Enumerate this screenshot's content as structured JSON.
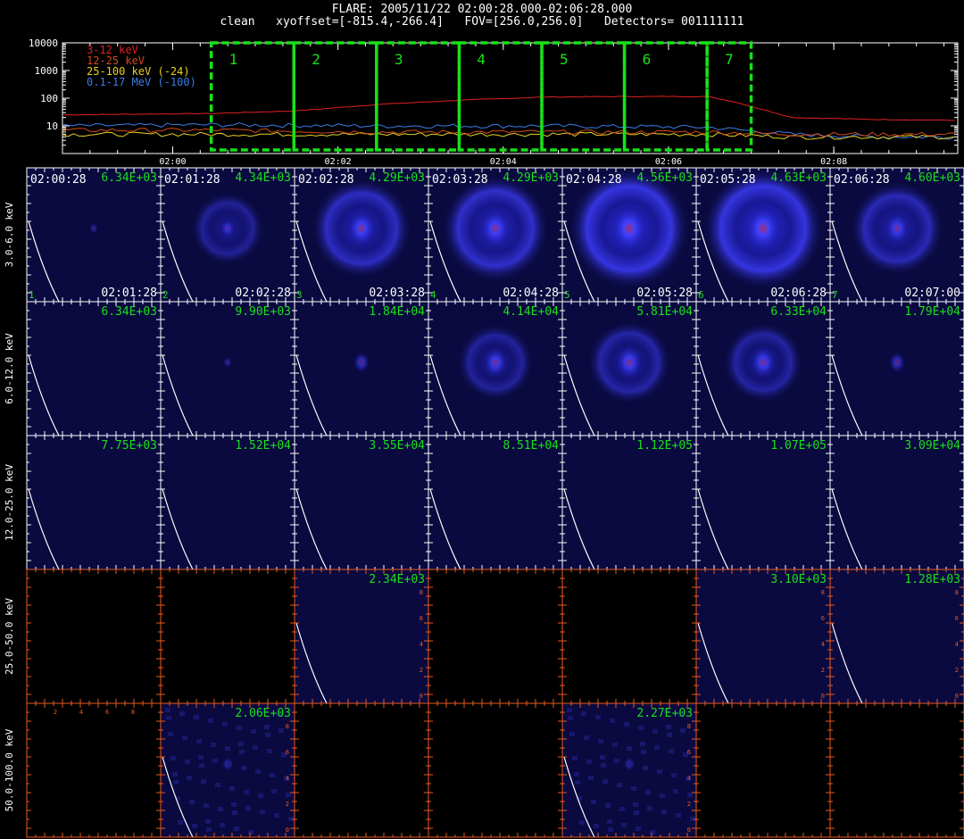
{
  "header": {
    "title": "FLARE: 2005/11/22 02:00:28.000-02:06:28.000",
    "subtitle": "clean   xyoffset=[-815.4,-266.4]   FOV=[256.0,256.0]   Detectors= 001111111"
  },
  "lightcurve": {
    "y_ticks": [
      "10000",
      "1000",
      "100",
      "10"
    ],
    "x_ticks": [
      "02:00",
      "02:02",
      "02:04",
      "02:06",
      "02:08"
    ],
    "legend": [
      {
        "label": "3-12 keV",
        "color": "#e02020"
      },
      {
        "label": "12-25 keV",
        "color": "#d44a1a"
      },
      {
        "label": "25-100 keV (-24)",
        "color": "#e8d020"
      },
      {
        "label": "0.1-17 MeV (-100)",
        "color": "#3a7de8"
      }
    ],
    "intervals": [
      "1",
      "2",
      "3",
      "4",
      "5",
      "6",
      "7"
    ],
    "interval_color": "#19e019"
  },
  "chart_data": {
    "type": "line",
    "title": "FLARE: 2005/11/22 02:00:28.000-02:06:28.000",
    "xlabel": "",
    "ylabel": "",
    "ylim": [
      1,
      10000
    ],
    "yscale": "log",
    "x_range": [
      "01:58:40",
      "02:09:30"
    ],
    "series": [
      {
        "name": "3-12 keV",
        "color": "#e02020",
        "x": [
          "01:58:40",
          "02:00:30",
          "02:01:30",
          "02:02:30",
          "02:03:30",
          "02:04:30",
          "02:05:30",
          "02:06:28",
          "02:06:45",
          "02:07:30",
          "02:08:30",
          "02:09:30"
        ],
        "values": [
          25,
          28,
          35,
          60,
          85,
          110,
          115,
          115,
          80,
          20,
          17,
          16
        ]
      },
      {
        "name": "0.1-17 MeV (-100)",
        "color": "#3a7de8",
        "x": [
          "01:58:40",
          "02:00:30",
          "02:02:30",
          "02:04:30",
          "02:06:28",
          "02:07:30",
          "02:08:30",
          "02:09:30"
        ],
        "values": [
          10,
          11,
          10,
          10,
          9,
          5,
          4,
          4
        ]
      },
      {
        "name": "25-100 keV (-24)",
        "color": "#e8d020",
        "x": [
          "01:58:40",
          "02:00:30",
          "02:02:30",
          "02:04:30",
          "02:06:28",
          "02:07:30",
          "02:08:30",
          "02:09:30"
        ],
        "values": [
          5,
          5,
          5,
          5,
          5,
          4,
          4,
          4
        ]
      },
      {
        "name": "12-25 keV",
        "color": "#d44a1a",
        "x": [
          "01:58:40",
          "02:00:30",
          "02:02:30",
          "02:04:30",
          "02:06:28",
          "02:07:30",
          "02:08:30",
          "02:09:30"
        ],
        "values": [
          7,
          7,
          6,
          6,
          6,
          5,
          5,
          5
        ]
      }
    ]
  },
  "image_grid": {
    "rows": [
      "3.0-6.0 keV",
      "6.0-12.0 keV",
      "12.0-25.0 keV",
      "25.0-50.0 keV",
      "50.0-100.0 keV"
    ],
    "start_times": [
      "02:00:28",
      "02:01:28",
      "02:02:28",
      "02:03:28",
      "02:04:28",
      "02:05:28",
      "02:06:28"
    ],
    "end_times": [
      "02:01:28",
      "02:02:28",
      "02:03:28",
      "02:04:28",
      "02:05:28",
      "02:06:28",
      "02:07:00"
    ],
    "peaks": [
      [
        "6.34E+03",
        "4.34E+03",
        "4.29E+03",
        "4.29E+03",
        "4.56E+03",
        "4.63E+03",
        "4.60E+03"
      ],
      [
        "6.34E+03",
        "9.90E+03",
        "1.84E+04",
        "4.14E+04",
        "5.81E+04",
        "6.33E+04",
        "1.79E+04"
      ],
      [
        "7.75E+03",
        "1.52E+04",
        "3.55E+04",
        "8.51E+04",
        "1.12E+05",
        "1.07E+05",
        "3.09E+04"
      ],
      [
        "",
        "",
        "2.34E+03",
        "",
        "",
        "3.10E+03",
        "1.28E+03"
      ],
      [
        "",
        "2.06E+03",
        "",
        "",
        "2.27E+03",
        "",
        ""
      ]
    ],
    "blank": [
      [
        false,
        false,
        false,
        false,
        false,
        false,
        false
      ],
      [
        false,
        false,
        false,
        false,
        false,
        false,
        false
      ],
      [
        false,
        false,
        false,
        false,
        false,
        false,
        false
      ],
      [
        true,
        true,
        false,
        true,
        true,
        false,
        false
      ],
      [
        true,
        false,
        true,
        true,
        false,
        true,
        true
      ]
    ],
    "source_level": [
      [
        0.05,
        0.25,
        0.75,
        0.8,
        1.0,
        1.0,
        0.6
      ],
      [
        0.0,
        0.05,
        0.35,
        0.6,
        0.7,
        0.65,
        0.35
      ],
      [
        0.0,
        0.0,
        0.0,
        0.0,
        0.0,
        0.0,
        0.0
      ],
      [
        0.0,
        0.0,
        0.0,
        0.0,
        0.0,
        0.0,
        0.0
      ],
      [
        0.0,
        0.15,
        0.0,
        0.0,
        0.15,
        0.0,
        0.0
      ]
    ],
    "ring_level": [
      [
        0.0,
        0.3,
        0.7,
        0.8,
        1.0,
        1.0,
        0.6
      ],
      [
        0.0,
        0.0,
        0.0,
        0.35,
        0.45,
        0.4,
        0.0
      ],
      [
        0.0,
        0.0,
        0.0,
        0.0,
        0.0,
        0.0,
        0.0
      ],
      [
        0.0,
        0.0,
        0.0,
        0.0,
        0.0,
        0.0,
        0.0
      ],
      [
        0.0,
        0.0,
        0.0,
        0.0,
        0.0,
        0.0,
        0.0
      ]
    ],
    "side_ticks": [
      "8",
      "6",
      "4",
      "2",
      "0"
    ],
    "top_ticks": [
      "2",
      "4",
      "6",
      "8"
    ],
    "peak_color": "#19e019",
    "tick_color": "#e85a20",
    "bg_color": "#0a0a40"
  }
}
